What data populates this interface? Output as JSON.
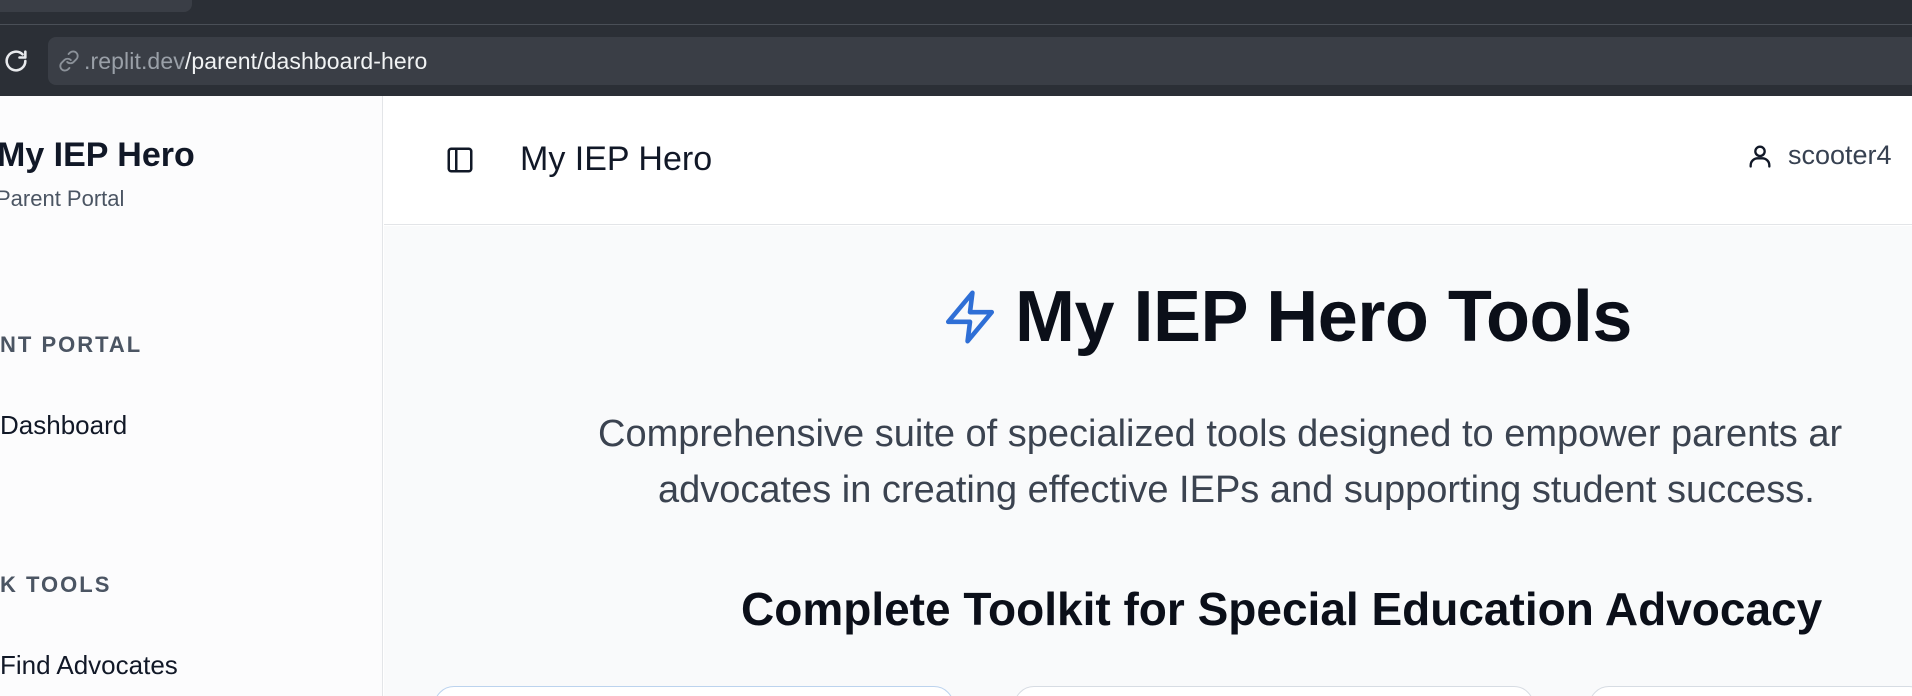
{
  "browser": {
    "url_domain": ".replit.dev",
    "url_path": "/parent/dashboard-hero"
  },
  "sidebar": {
    "brand_title": "My IEP Hero",
    "brand_subtitle": "Parent Portal",
    "sections": [
      {
        "label": "NT PORTAL",
        "items": [
          {
            "label": "Dashboard"
          }
        ]
      },
      {
        "label": "K TOOLS",
        "items": [
          {
            "label": "Find Advocates"
          }
        ]
      }
    ]
  },
  "header": {
    "title": "My IEP Hero",
    "user_name": "scooter4"
  },
  "hero": {
    "title": "My IEP Hero Tools",
    "description_line1": "Comprehensive suite of specialized tools designed to empower parents ar",
    "description_line2": "advocates in creating effective IEPs and supporting student success.",
    "toolkit_heading": "Complete Toolkit for Special Education Advocacy"
  },
  "icons": {
    "reload": "reload-icon",
    "url": "link-icon",
    "sidebar_toggle": "sidebar-panel-icon",
    "user": "user-icon",
    "hero": "lightning-bolt-icon"
  },
  "colors": {
    "accent": "#2f6fd6",
    "browser_chrome": "#2b2f36",
    "url_bar": "#3a3e46",
    "content_bg": "#f9fafb",
    "text_primary": "#0b0f19"
  }
}
